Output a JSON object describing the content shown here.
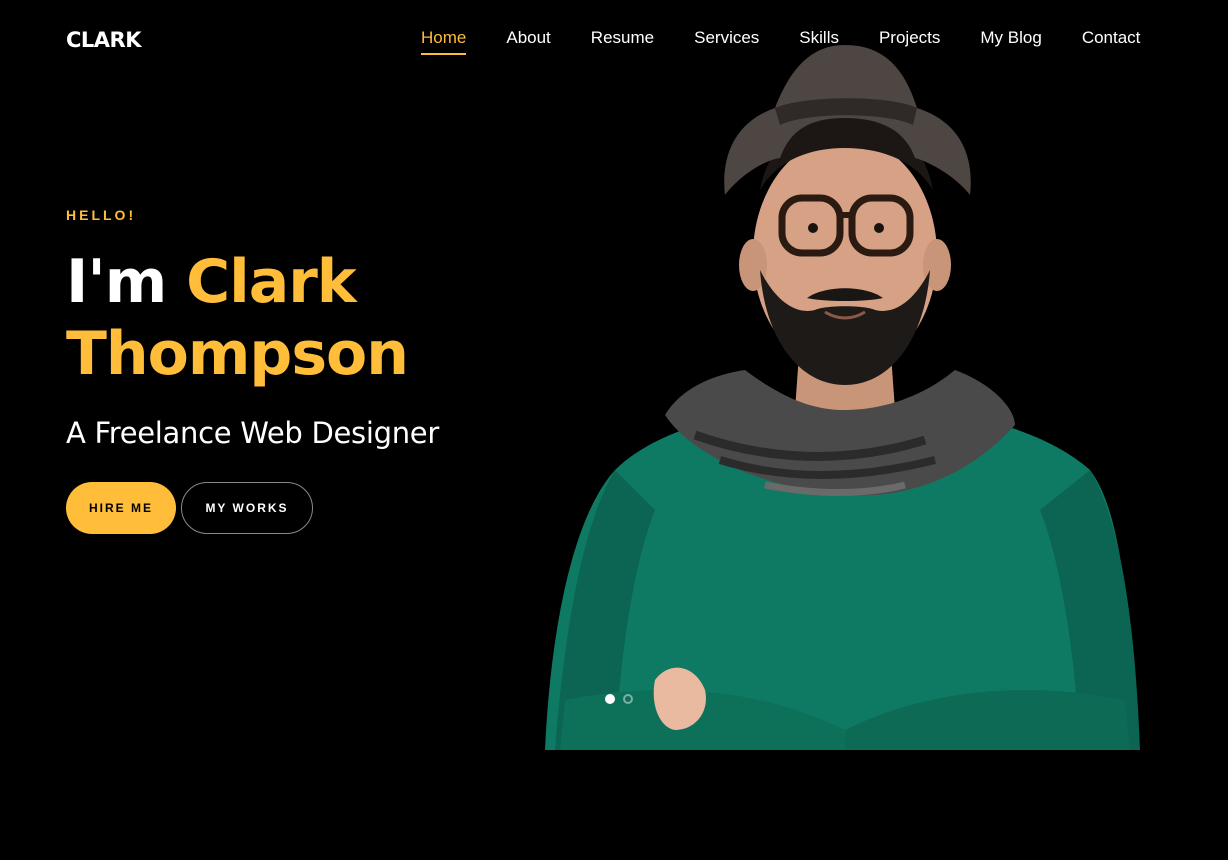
{
  "brand": {
    "logo": "CLARK"
  },
  "nav": {
    "items": [
      {
        "label": "Home",
        "active": true
      },
      {
        "label": "About"
      },
      {
        "label": "Resume"
      },
      {
        "label": "Services"
      },
      {
        "label": "Skills"
      },
      {
        "label": "Projects"
      },
      {
        "label": "My Blog"
      },
      {
        "label": "Contact"
      }
    ]
  },
  "hero": {
    "greeting": "HELLO!",
    "intro": "I'm",
    "first_name": "Clark",
    "last_name": "Thompson",
    "subtitle": "A Freelance Web Designer",
    "hire_label": "HIRE ME",
    "works_label": "MY WORKS"
  },
  "slider": {
    "slide_count": 2,
    "active_slide": 1
  },
  "colors": {
    "accent": "#ffbd39",
    "background": "#000000",
    "text": "#ffffff",
    "sweater": "#0f7a63"
  },
  "icons": [
    "portrait-photo"
  ]
}
